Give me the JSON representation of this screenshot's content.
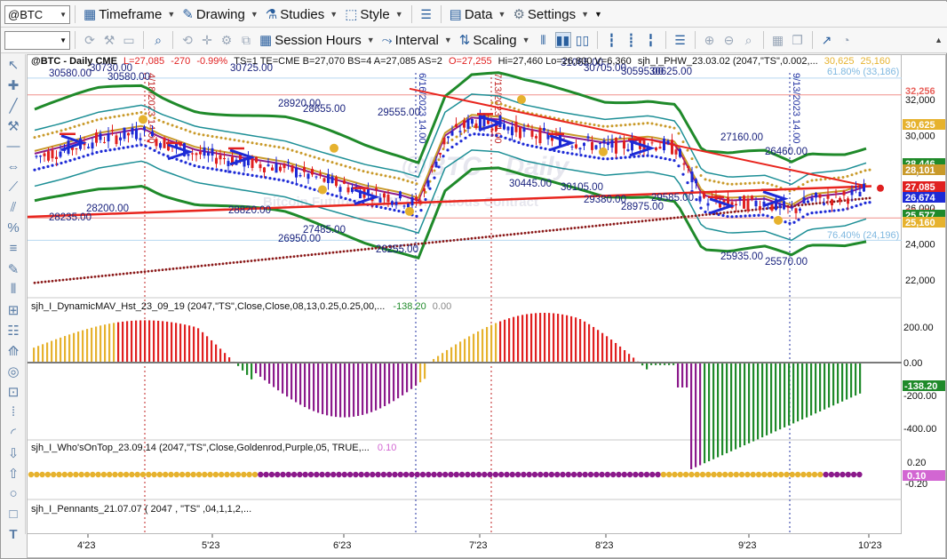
{
  "toolbar1": {
    "symbol": "@BTC",
    "timeframe": "Timeframe",
    "drawing": "Drawing",
    "studies": "Studies",
    "style": "Style",
    "data": "Data",
    "settings": "Settings"
  },
  "toolbar2": {
    "session_hours": "Session Hours",
    "interval": "Interval",
    "scaling": "Scaling"
  },
  "header": {
    "symbol": "@BTC - Daily  CME",
    "L": "L=27,085",
    "chg": "-270",
    "pct": "-0.99%",
    "rest": "TS=1  TE=CME  B=27,070  BS=4  A=27,085  AS=2",
    "open": "O=27,255",
    "hlv": "Hi=27,460  Lo=26,800  V=6,360",
    "study": "sjh_I_PHW_23.03.02 (2047,\"TS\",0.002,...",
    "v1": "30,625",
    "v2": "25,160"
  },
  "watermark": {
    "main": "@BTC - Daily",
    "sub": "Bitcoin Futures - CME Continuous Contract"
  },
  "subcharts": {
    "p1_title": "sjh_I_DynamicMAV_Hst_23_09_19 (2047,\"TS\",Close,Close,08,13,0.25,0.25,00,...",
    "p1_v1": "-138.20",
    "p1_v2": "0.00",
    "p2_title": "sjh_I_Who'sOnTop_23.09.14 (2047,\"TS\",Close,Goldenrod,Purple,05,  TRUE,...",
    "p2_v1": "0.10",
    "p3_title": "sjh_I_Pennants_21.07.07 (  2047 ,  \"TS\" ,04,1,1,2,..."
  },
  "price_axis": {
    "ticks": [
      "32,000",
      "30,000",
      "28,000",
      "26,000",
      "24,000",
      "22,000"
    ],
    "badges": [
      {
        "text": "32,256",
        "color": "#e8605a",
        "textcolor": "#e8605a",
        "fill": "none"
      },
      {
        "text": "30,625",
        "color": "#e6b22e",
        "textcolor": "#ffffff",
        "fill": "#e6b22e"
      },
      {
        "text": "28,446",
        "color": "#1f8a2a",
        "textcolor": "#ffffff",
        "fill": "#1f8a2a"
      },
      {
        "text": "28,101",
        "color": "#c99a2a",
        "textcolor": "#ffffff",
        "fill": "#c99a2a"
      },
      {
        "text": "27,085",
        "color": "#e02020",
        "textcolor": "#ffffff",
        "fill": "#e02020"
      },
      {
        "text": "26,674",
        "color": "#1d2ad6",
        "textcolor": "#ffffff",
        "fill": "#1d2ad6"
      },
      {
        "text": "25,434",
        "color": "#e8605a",
        "textcolor": "#e8605a",
        "fill": "none"
      },
      {
        "text": "25,577",
        "color": "#1f8a2a",
        "textcolor": "#ffffff",
        "fill": "#1f8a2a"
      },
      {
        "text": "25,160",
        "color": "#e6b22e",
        "textcolor": "#ffffff",
        "fill": "#e6b22e"
      }
    ],
    "fib_high": "61.80% (33,186)",
    "fib_low": "76.40% (24,196)",
    "osc_ticks": [
      "200.00",
      "0.00",
      "-200.00",
      "-400.00"
    ],
    "osc_badge": "-138.20",
    "wot_ticks": [
      "0.20",
      "-0.20"
    ],
    "wot_badge": "0.10"
  },
  "date_axis": [
    "4'23",
    "5'23",
    "6'23",
    "7'23",
    "8'23",
    "9'23",
    "10'23"
  ],
  "annotations": [
    "30580.00",
    "30730.00",
    "30580.00",
    "30725.00",
    "28920.00",
    "28655.00",
    "28235.00",
    "28200.00",
    "28820.00",
    "27485.00",
    "26950.00",
    "26255.00",
    "30445.00",
    "30105.00",
    "29380.00",
    "28975.00",
    "29585.00",
    "27160.00",
    "26460.00",
    "25935.00",
    "25570.00",
    "30705.00",
    "30595.00",
    "30625.00",
    "31065.00",
    "29555.00"
  ],
  "vlines": [
    "4/18/2023 14.00",
    "6/16/2023 14.00",
    "7/13/2023 14.00",
    "9/13/2023 14.00"
  ],
  "colors": {
    "green_band": "#1f8a2a",
    "teal_band": "#1d8f96",
    "candles_blue": "#1d2ad6",
    "candles_red": "#e02020",
    "goldenrod": "#e6b22e",
    "purple": "#8b1a8b",
    "support_red": "#e8251e"
  }
}
